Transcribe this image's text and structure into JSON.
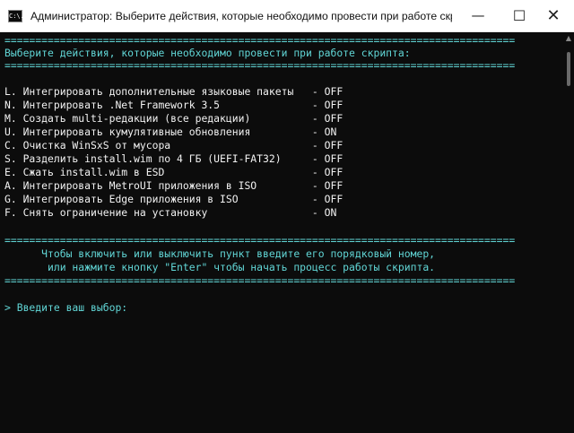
{
  "window": {
    "title": "Администратор:  Выберите действия, которые необходимо провести при работе скрипта...",
    "icon_text": "C:\\."
  },
  "console": {
    "line_rule_top": "===================================================================================",
    "header": "Выберите действия, которые необходимо провести при работе скрипта:",
    "line_rule_2": "===================================================================================",
    "items": [
      "L. Интегрировать дополнительные языковые пакеты   - OFF",
      "N. Интегрировать .Net Framework 3.5               - OFF",
      "M. Создать multi-редакции (все редакции)          - OFF",
      "U. Интегрировать кумулятивные обновления          - ON",
      "C. Очистка WinSxS от мусора                       - OFF",
      "S. Разделить install.wim по 4 ГБ (UEFI-FAT32)     - OFF",
      "E. Сжать install.wim в ESD                        - OFF",
      "A. Интегрировать MetroUI приложения в ISO         - OFF",
      "G. Интегрировать Edge приложения в ISO            - OFF",
      "F. Снять ограничение на установку                 - ON"
    ],
    "line_rule_3": "===================================================================================",
    "hint_1": "      Чтобы включить или выключить пункт введите его порядковый номер,",
    "hint_2": "       или нажмите кнопку \"Enter\" чтобы начать процесс работы скрипта.",
    "line_rule_4": "===================================================================================",
    "prompt": "> Введите ваш выбор:"
  }
}
